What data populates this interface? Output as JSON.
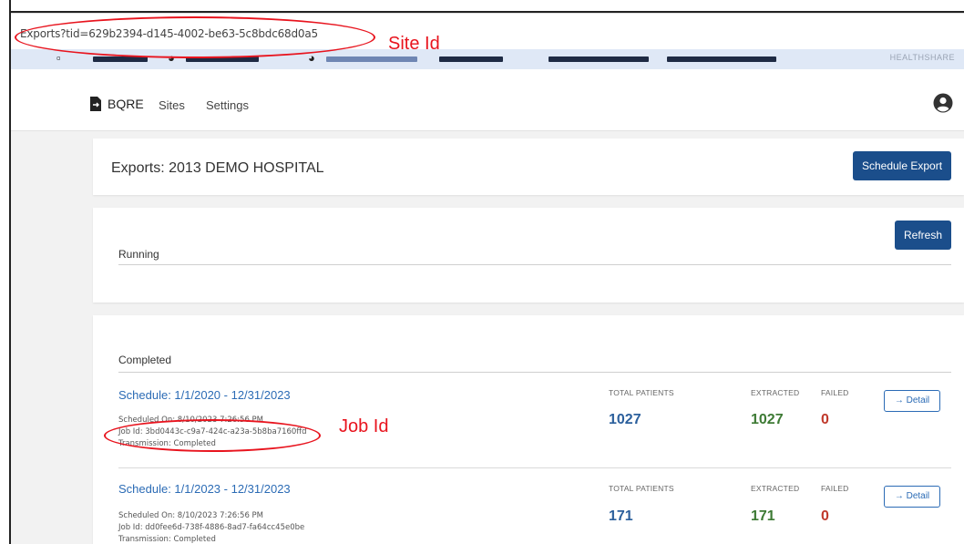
{
  "browser": {
    "url": "Exports?tid=629b2394-d145-4002-be63-5c8bdc68d0a5",
    "bookmarks_trailing": "HEALTHSHARE"
  },
  "nav": {
    "brand": "BQRE",
    "links": [
      "Sites",
      "Settings"
    ]
  },
  "header": {
    "title": "Exports: 2013 DEMO HOSPITAL",
    "schedule_button": "Schedule Export"
  },
  "running": {
    "label": "Running",
    "refresh_button": "Refresh"
  },
  "completed": {
    "label": "Completed",
    "stat_headers": {
      "total": "TOTAL PATIENTS",
      "extracted": "EXTRACTED",
      "failed": "FAILED"
    },
    "detail_label": "→ Detail",
    "jobs": [
      {
        "schedule": "Schedule: 1/1/2020 - 12/31/2023",
        "scheduled_on": "Scheduled On: 8/10/2023 7:26:56 PM",
        "job_id": "Job Id: 3bd0443c-c9a7-424c-a23a-5b8ba7160ffd",
        "transmission": "Transmission: Completed",
        "total_patients": "1027",
        "extracted": "1027",
        "failed": "0"
      },
      {
        "schedule": "Schedule: 1/1/2023 - 12/31/2023",
        "scheduled_on": "Scheduled On: 8/10/2023 7:26:56 PM",
        "job_id": "Job Id: dd0fee6d-738f-4886-8ad7-fa64cc45e0be",
        "transmission": "Transmission: Completed",
        "total_patients": "171",
        "extracted": "171",
        "failed": "0"
      }
    ]
  },
  "annotations": {
    "site_id": "Site Id",
    "job_id": "Job Id",
    "color": "#e8141e"
  },
  "colors": {
    "primary": "#1b4e8b",
    "link": "#2b6bb5",
    "extracted": "#3d7a34",
    "failed": "#c0392b"
  }
}
